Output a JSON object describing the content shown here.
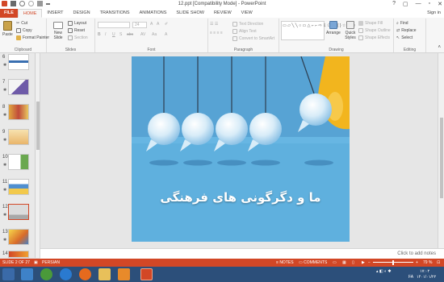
{
  "window": {
    "title": "12.ppt [Compatibility Mode] - PowerPoint",
    "controls": [
      "?",
      "▢",
      "—",
      "▫",
      "✕"
    ]
  },
  "tabs": [
    "FILE",
    "HOME",
    "INSERT",
    "DESIGN",
    "TRANSITIONS",
    "ANIMATIONS",
    "SLIDE SHOW",
    "REVIEW",
    "VIEW"
  ],
  "active_tab": "HOME",
  "signin": "Sign in",
  "ribbon": {
    "clipboard": {
      "label": "Clipboard",
      "paste": "Paste",
      "cut": "Cut",
      "copy": "Copy",
      "format_painter": "Format Painter"
    },
    "slides": {
      "label": "Slides",
      "new_slide": "New Slide",
      "layout": "Layout",
      "reset": "Reset",
      "section": "Section"
    },
    "font": {
      "label": "Font",
      "size": "24",
      "bold": "B",
      "italic": "I",
      "underline": "U",
      "shadow": "S",
      "strike": "abc"
    },
    "paragraph": {
      "label": "Paragraph",
      "text_direction": "Text Direction",
      "align_text": "Align Text",
      "smartart": "Convert to SmartArt"
    },
    "drawing": {
      "label": "Drawing",
      "arrange": "Arrange",
      "quick_styles": "Quick Styles",
      "shape_fill": "Shape Fill",
      "shape_outline": "Shape Outline",
      "shape_effects": "Shape Effects"
    },
    "editing": {
      "label": "Editing",
      "find": "Find",
      "replace": "Replace",
      "select": "Select"
    }
  },
  "thumbnails": [
    {
      "num": "6",
      "selected": false
    },
    {
      "num": "7",
      "selected": false
    },
    {
      "num": "8",
      "selected": false
    },
    {
      "num": "9",
      "selected": false
    },
    {
      "num": "10",
      "selected": false
    },
    {
      "num": "11",
      "selected": false
    },
    {
      "num": "12",
      "selected": true
    },
    {
      "num": "13",
      "selected": false
    },
    {
      "num": "14",
      "selected": false
    }
  ],
  "slide": {
    "title": "ما و دگرگونی های فرهنگی"
  },
  "notes": {
    "placeholder": "Click to add notes"
  },
  "status": {
    "slide_info": "SLIDE 2 OF 27",
    "language": "PERSIAN",
    "notes": "NOTES",
    "comments": "COMMENTS",
    "zoom": "79 %"
  },
  "taskbar": {
    "lang": "FA",
    "time": "۱۷:۰۲",
    "date": "۱۴۰۱/۰۱/۲۲"
  },
  "colors": {
    "accent": "#d24726",
    "slide_bg": "#57a3d4",
    "taskbar": "#2c4f7a"
  }
}
